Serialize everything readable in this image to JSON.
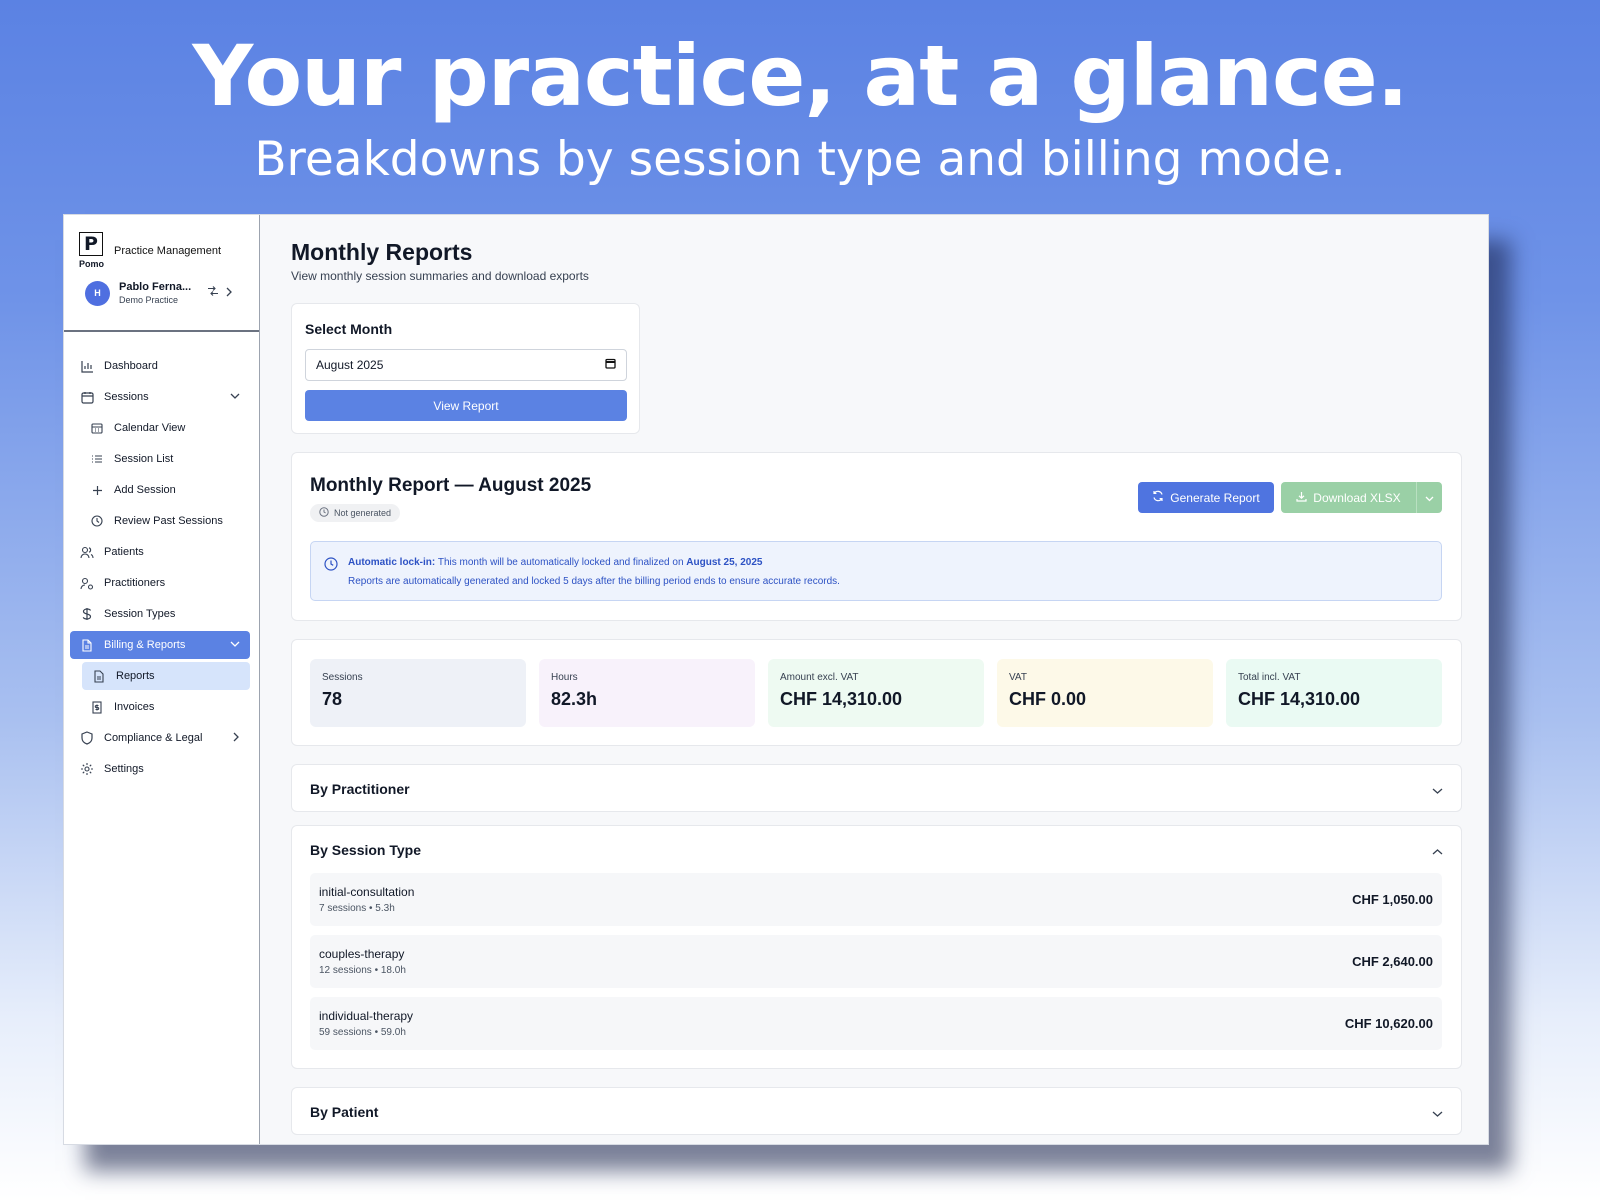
{
  "hero": {
    "title": "Your practice, at a glance.",
    "subtitle": "Breakdowns by session type and billing mode."
  },
  "brand": {
    "logo_letter": "P",
    "name": "Pomo",
    "label": "Practice Management"
  },
  "user": {
    "initial": "H",
    "name": "Pablo Ferna...",
    "practice": "Demo Practice"
  },
  "nav": {
    "dashboard": "Dashboard",
    "sessions": "Sessions",
    "calendar_view": "Calendar View",
    "session_list": "Session List",
    "add_session": "Add Session",
    "review_past": "Review Past Sessions",
    "patients": "Patients",
    "practitioners": "Practitioners",
    "session_types": "Session Types",
    "billing_reports": "Billing & Reports",
    "reports": "Reports",
    "invoices": "Invoices",
    "compliance": "Compliance & Legal",
    "settings": "Settings"
  },
  "page": {
    "title": "Monthly Reports",
    "description": "View monthly session summaries and download exports"
  },
  "month_select": {
    "label": "Select Month",
    "value": "August 2025",
    "button": "View Report"
  },
  "report": {
    "title": "Monthly Report — August 2025",
    "status": "Not generated",
    "generate_button": "Generate Report",
    "download_button": "Download XLSX",
    "lock_label": "Automatic lock-in:",
    "lock_text": " This month will be automatically locked and finalized on ",
    "lock_date": "August 25, 2025",
    "lock_line2": "Reports are automatically generated and locked 5 days after the billing period ends to ensure accurate records."
  },
  "stats": [
    {
      "label": "Sessions",
      "value": "78",
      "color": "#eef1f7"
    },
    {
      "label": "Hours",
      "value": "82.3h",
      "color": "#f8f2fb"
    },
    {
      "label": "Amount excl. VAT",
      "value": "CHF 14,310.00",
      "color": "#eefaf2"
    },
    {
      "label": "VAT",
      "value": "CHF 0.00",
      "color": "#fdf9e8"
    },
    {
      "label": "Total incl. VAT",
      "value": "CHF 14,310.00",
      "color": "#eafaf3"
    }
  ],
  "sections": {
    "by_practitioner": "By Practitioner",
    "by_session_type": "By Session Type",
    "by_patient": "By Patient"
  },
  "session_types": [
    {
      "name": "initial-consultation",
      "meta": "7 sessions • 5.3h",
      "amount": "CHF 1,050.00"
    },
    {
      "name": "couples-therapy",
      "meta": "12 sessions • 18.0h",
      "amount": "CHF 2,640.00"
    },
    {
      "name": "individual-therapy",
      "meta": "59 sessions • 59.0h",
      "amount": "CHF 10,620.00"
    }
  ],
  "colors": {
    "accent": "#5b82e3",
    "download": "#9ad0a6",
    "note_text": "#2d52c4"
  }
}
